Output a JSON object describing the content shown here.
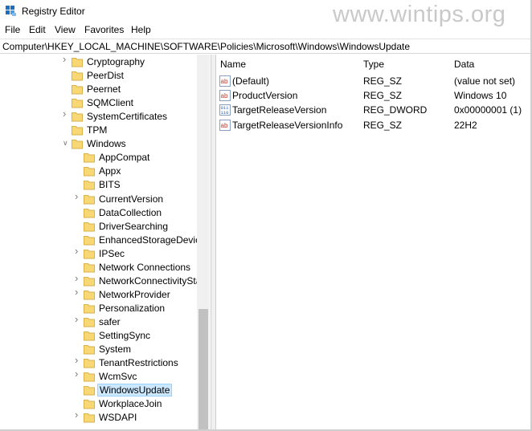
{
  "window": {
    "title": "Registry Editor",
    "watermark": "www.wintips.org"
  },
  "menu": [
    "File",
    "Edit",
    "View",
    "Favorites",
    "Help"
  ],
  "address": "Computer\\HKEY_LOCAL_MACHINE\\SOFTWARE\\Policies\\Microsoft\\Windows\\WindowsUpdate",
  "tree": {
    "nodes": [
      {
        "label": "Cryptography",
        "level": 0,
        "chevron": "right",
        "selected": false
      },
      {
        "label": "PeerDist",
        "level": 0,
        "chevron": "none",
        "selected": false
      },
      {
        "label": "Peernet",
        "level": 0,
        "chevron": "none",
        "selected": false
      },
      {
        "label": "SQMClient",
        "level": 0,
        "chevron": "none",
        "selected": false
      },
      {
        "label": "SystemCertificates",
        "level": 0,
        "chevron": "right",
        "selected": false
      },
      {
        "label": "TPM",
        "level": 0,
        "chevron": "none",
        "selected": false
      },
      {
        "label": "Windows",
        "level": 0,
        "chevron": "down",
        "selected": false
      },
      {
        "label": "AppCompat",
        "level": 1,
        "chevron": "none",
        "selected": false
      },
      {
        "label": "Appx",
        "level": 1,
        "chevron": "none",
        "selected": false
      },
      {
        "label": "BITS",
        "level": 1,
        "chevron": "none",
        "selected": false
      },
      {
        "label": "CurrentVersion",
        "level": 1,
        "chevron": "right",
        "selected": false
      },
      {
        "label": "DataCollection",
        "level": 1,
        "chevron": "none",
        "selected": false
      },
      {
        "label": "DriverSearching",
        "level": 1,
        "chevron": "none",
        "selected": false
      },
      {
        "label": "EnhancedStorageDevice",
        "level": 1,
        "chevron": "none",
        "selected": false
      },
      {
        "label": "IPSec",
        "level": 1,
        "chevron": "right",
        "selected": false
      },
      {
        "label": "Network Connections",
        "level": 1,
        "chevron": "none",
        "selected": false
      },
      {
        "label": "NetworkConnectivitySta",
        "level": 1,
        "chevron": "right",
        "selected": false
      },
      {
        "label": "NetworkProvider",
        "level": 1,
        "chevron": "right",
        "selected": false
      },
      {
        "label": "Personalization",
        "level": 1,
        "chevron": "none",
        "selected": false
      },
      {
        "label": "safer",
        "level": 1,
        "chevron": "right",
        "selected": false
      },
      {
        "label": "SettingSync",
        "level": 1,
        "chevron": "none",
        "selected": false
      },
      {
        "label": "System",
        "level": 1,
        "chevron": "none",
        "selected": false
      },
      {
        "label": "TenantRestrictions",
        "level": 1,
        "chevron": "right",
        "selected": false
      },
      {
        "label": "WcmSvc",
        "level": 1,
        "chevron": "right",
        "selected": false
      },
      {
        "label": "WindowsUpdate",
        "level": 1,
        "chevron": "none",
        "selected": true
      },
      {
        "label": "WorkplaceJoin",
        "level": 1,
        "chevron": "none",
        "selected": false
      },
      {
        "label": "WSDAPI",
        "level": 1,
        "chevron": "right",
        "selected": false
      }
    ]
  },
  "list": {
    "columns": [
      "Name",
      "Type",
      "Data"
    ],
    "rows": [
      {
        "icon": "string-value-icon",
        "name": "(Default)",
        "type": "REG_SZ",
        "data": "(value not set)"
      },
      {
        "icon": "string-value-icon",
        "name": "ProductVersion",
        "type": "REG_SZ",
        "data": "Windows 10"
      },
      {
        "icon": "dword-value-icon",
        "name": "TargetReleaseVersion",
        "type": "REG_DWORD",
        "data": "0x00000001 (1)"
      },
      {
        "icon": "string-value-icon",
        "name": "TargetReleaseVersionInfo",
        "type": "REG_SZ",
        "data": "22H2"
      }
    ]
  },
  "colors": {
    "selection_bg": "#cce8ff",
    "selection_border": "#99d1ff",
    "folder": "#f8d775",
    "string_icon": "#c0392b",
    "dword_icon": "#1f5fbf"
  }
}
